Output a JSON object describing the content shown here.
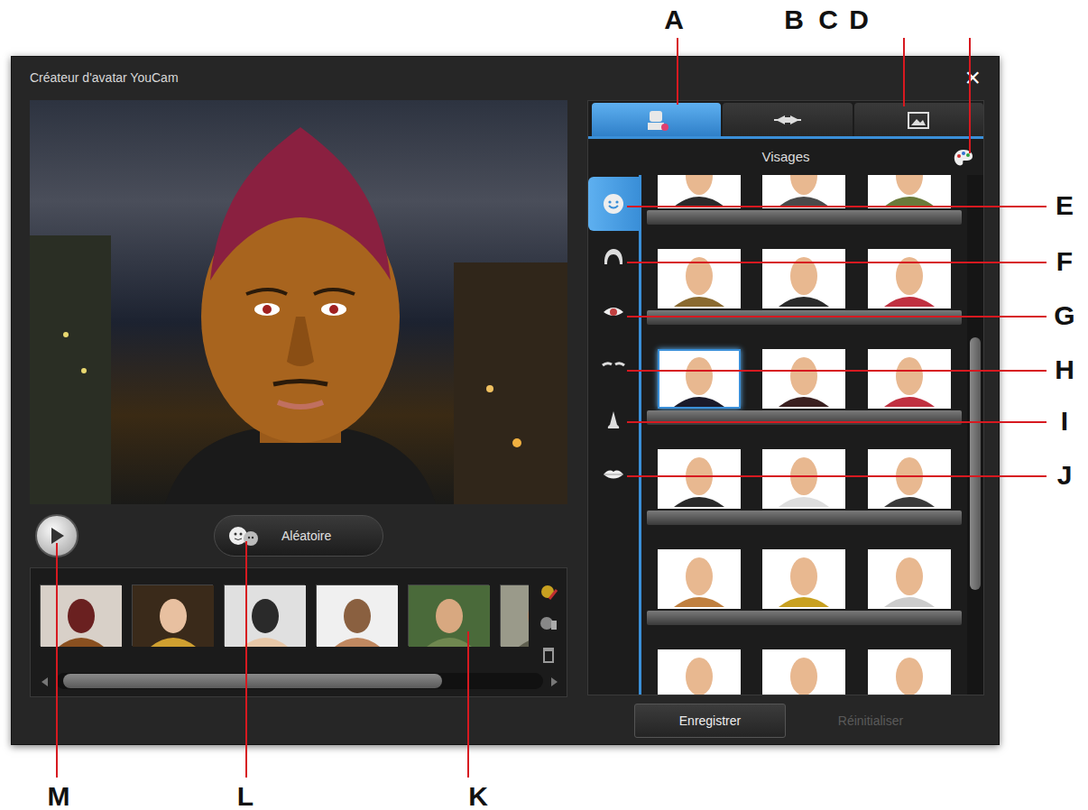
{
  "window": {
    "title": "Créateur d'avatar YouCam",
    "close": "×"
  },
  "tabs": [
    {
      "selected": true
    },
    {
      "selected": false
    },
    {
      "selected": false
    }
  ],
  "panel": {
    "title": "Visages"
  },
  "categories": [
    {
      "selected": true
    },
    {
      "selected": false
    },
    {
      "selected": false
    },
    {
      "selected": false
    },
    {
      "selected": false
    },
    {
      "selected": false
    }
  ],
  "faces": [
    {
      "selected": false
    },
    {
      "selected": false
    },
    {
      "selected": false
    },
    {
      "selected": false
    },
    {
      "selected": false
    },
    {
      "selected": false
    },
    {
      "selected": true
    },
    {
      "selected": false
    },
    {
      "selected": false
    },
    {
      "selected": false
    },
    {
      "selected": false
    },
    {
      "selected": false
    },
    {
      "selected": false
    },
    {
      "selected": false
    },
    {
      "selected": false
    },
    {
      "selected": false
    },
    {
      "selected": false
    },
    {
      "selected": false
    }
  ],
  "random_button": {
    "label": "Aléatoire"
  },
  "buttons": [
    {
      "label": "Enregistrer",
      "disabled": false
    },
    {
      "label": "Réinitialiser",
      "disabled": true
    }
  ],
  "callouts": [
    {
      "label": "A"
    },
    {
      "label": "B"
    },
    {
      "label": "C"
    },
    {
      "label": "D"
    },
    {
      "label": "E"
    },
    {
      "label": "F"
    },
    {
      "label": "G"
    },
    {
      "label": "H"
    },
    {
      "label": "I"
    },
    {
      "label": "J"
    },
    {
      "label": "K"
    },
    {
      "label": "L"
    },
    {
      "label": "M"
    }
  ]
}
